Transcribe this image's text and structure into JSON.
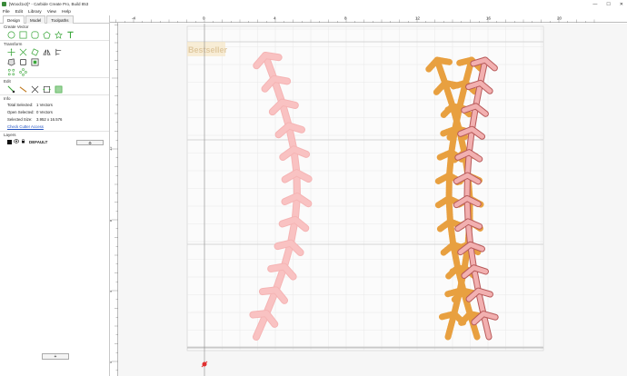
{
  "window": {
    "title": "[Wood1x2]* - Carbide Create Pro, Build 853",
    "controls": [
      "—",
      "☐",
      "✕"
    ]
  },
  "menu": [
    "File",
    "Edit",
    "Library",
    "View",
    "Help"
  ],
  "tabs": [
    "Design",
    "Model",
    "Toolpaths"
  ],
  "sections": {
    "create_vector": "Create Vector",
    "transform": "Transform",
    "edit": "Edit",
    "info": "Info",
    "layers": "Layers"
  },
  "info": {
    "total_selected_label": "Total Selected:",
    "total_selected_value": "1 Vectors",
    "open_selected_label": "Open Selected:",
    "open_selected_value": "0 Vectors",
    "selected_size_label": "Selected Size:",
    "selected_size_value": "3.952 x 16.576",
    "check_link": "Check Cutter Access"
  },
  "layers": {
    "default_name": "DEFAULT",
    "add_label": "+"
  },
  "ruler": {
    "h_labels": [
      "-4",
      "0",
      "4",
      "8",
      "12",
      "16",
      "20"
    ],
    "v_labels": [
      "12",
      "8",
      "4",
      "0"
    ]
  },
  "canvas": {
    "watermark": "Bestseller"
  },
  "colors": {
    "accent_green": "#3aa63a",
    "stitch_fill": "#f7b3b3",
    "stitch_stroke": "#e07a7a",
    "outline_orange": "#e8a040"
  },
  "icons": {
    "create_vector": [
      "circle-icon",
      "rectangle-icon",
      "rounded-rectangle-icon",
      "polygon-icon",
      "star-icon",
      "text-icon"
    ],
    "transform_row1": [
      "move-icon",
      "scale-icon",
      "rotate-icon",
      "mirror-icon",
      "align-icon"
    ],
    "transform_row2": [
      "offset-icon",
      "weld-icon",
      "subtract-icon"
    ],
    "transform_row3": [
      "array-icon",
      "circular-array-icon"
    ],
    "edit": [
      "node-edit-icon",
      "trim-icon",
      "join-icon",
      "bounding-box-icon",
      "boolean-icon"
    ]
  }
}
